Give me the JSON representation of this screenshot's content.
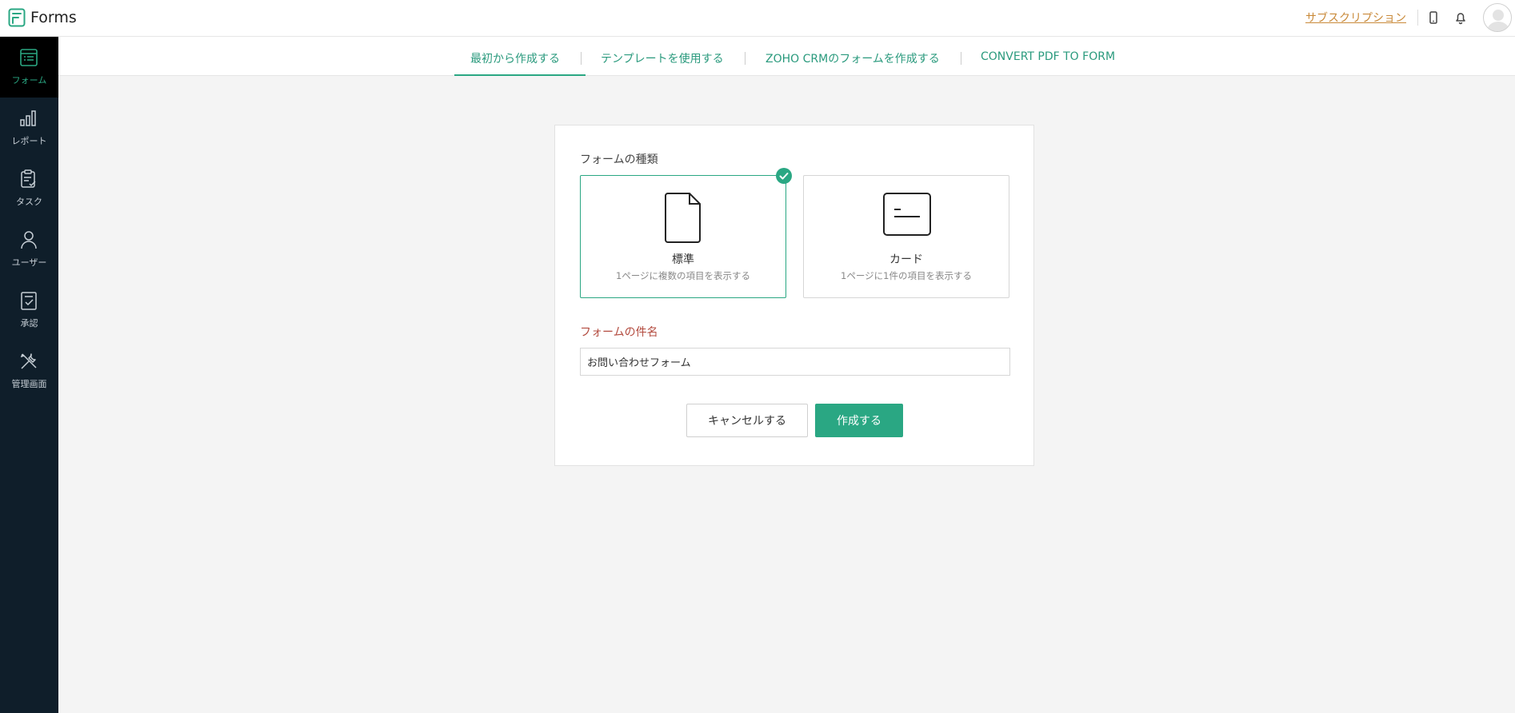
{
  "app": {
    "title": "Forms"
  },
  "header": {
    "subscription_label": "サブスクリプション",
    "icons": [
      "mobile-icon",
      "bell-icon",
      "avatar"
    ]
  },
  "sidebar": {
    "items": [
      {
        "label": "フォーム",
        "icon": "form-icon",
        "active": true
      },
      {
        "label": "レポート",
        "icon": "report-chart-icon",
        "active": false
      },
      {
        "label": "タスク",
        "icon": "task-clipboard-icon",
        "active": false
      },
      {
        "label": "ユーザー",
        "icon": "user-icon",
        "active": false
      },
      {
        "label": "承認",
        "icon": "approval-icon",
        "active": false
      },
      {
        "label": "管理画面",
        "icon": "admin-tools-icon",
        "active": false
      }
    ]
  },
  "tabs": [
    {
      "label": "最初から作成する",
      "active": true
    },
    {
      "label": "テンプレートを使用する",
      "active": false
    },
    {
      "label": "ZOHO CRMのフォームを作成する",
      "active": false
    },
    {
      "label": "CONVERT PDF TO FORM",
      "active": false
    }
  ],
  "form": {
    "type_label": "フォームの種類",
    "types": [
      {
        "name": "標準",
        "description": "1ページに複数の項目を表示する",
        "icon": "document-icon",
        "selected": true
      },
      {
        "name": "カード",
        "description": "1ページに1件の項目を表示する",
        "icon": "card-icon",
        "selected": false
      }
    ],
    "name_label": "フォームの件名",
    "name_value": "お問い合わせフォーム",
    "cancel_label": "キャンセルする",
    "create_label": "作成する"
  },
  "colors": {
    "accent": "#2aa783",
    "sidebar": "#0f1e2a",
    "required_label": "#b34b3f",
    "subscription": "#c98a3a"
  }
}
